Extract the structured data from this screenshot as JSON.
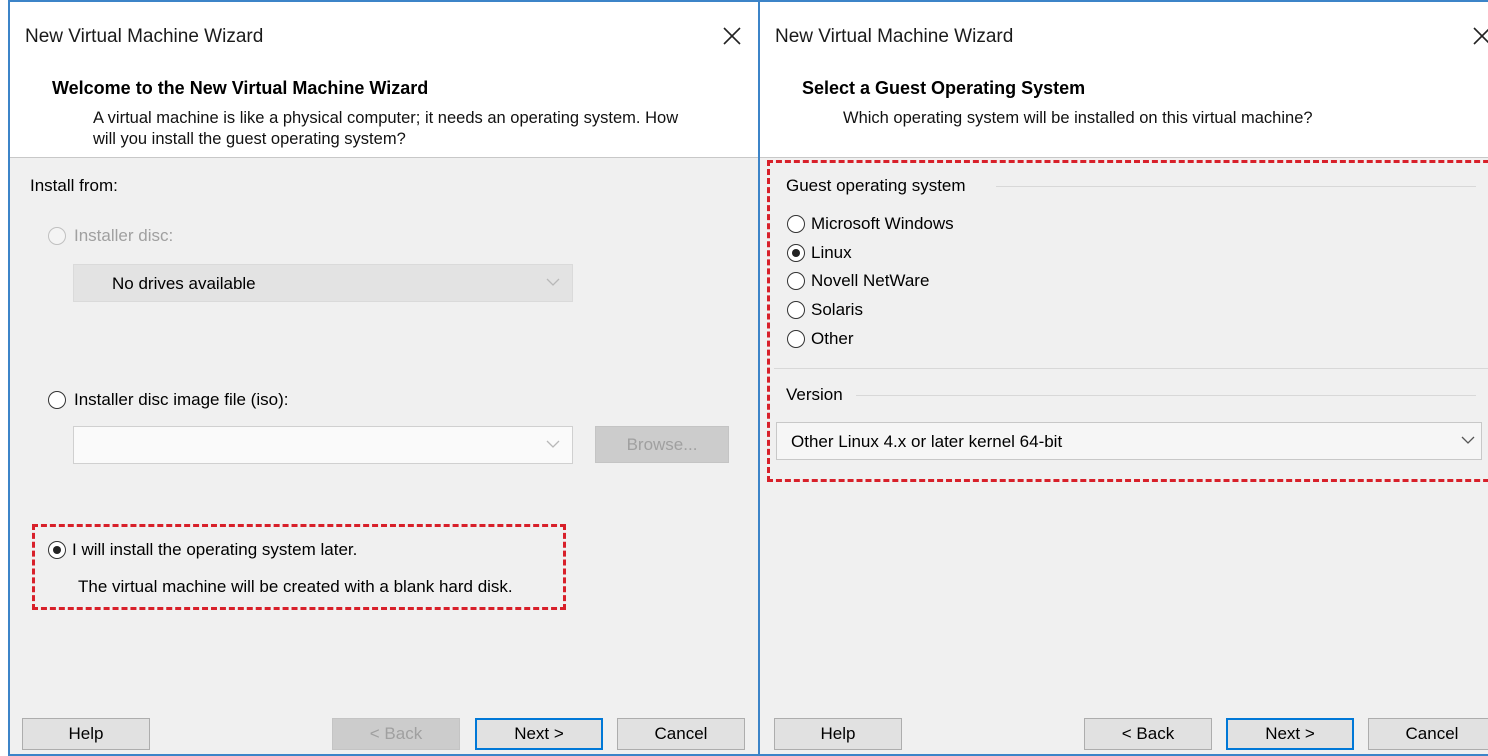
{
  "left_window": {
    "title": "New Virtual Machine Wizard",
    "heading": "Welcome to the New Virtual Machine Wizard",
    "subheading": "A virtual machine is like a physical computer; it needs an operating system. How will you install the guest operating system?",
    "install_from_label": "Install from:",
    "installer_disc_label": "Installer disc:",
    "drives_value": "No drives available",
    "iso_label": "Installer disc image file (iso):",
    "iso_value": "",
    "browse_label": "Browse...",
    "install_later_label": "I will install the operating system later.",
    "install_later_note": "The virtual machine will be created with a blank hard disk.",
    "selected_option": "install_later",
    "buttons": {
      "help": "Help",
      "back": "< Back",
      "next": "Next >",
      "cancel": "Cancel"
    }
  },
  "right_window": {
    "title": "New Virtual Machine Wizard",
    "heading": "Select a Guest Operating System",
    "subheading": "Which operating system will be installed on this virtual machine?",
    "guest_os_group": "Guest operating system",
    "os_options": [
      "Microsoft Windows",
      "Linux",
      "Novell NetWare",
      "Solaris",
      "Other"
    ],
    "selected_os": "Linux",
    "version_group": "Version",
    "version_value": "Other Linux 4.x or later kernel 64-bit",
    "buttons": {
      "help": "Help",
      "back": "< Back",
      "next": "Next >",
      "cancel": "Cancel"
    }
  },
  "colors": {
    "window_border": "#3c84c8",
    "highlight_dash": "#d8202a",
    "default_button_border": "#0078d7"
  }
}
